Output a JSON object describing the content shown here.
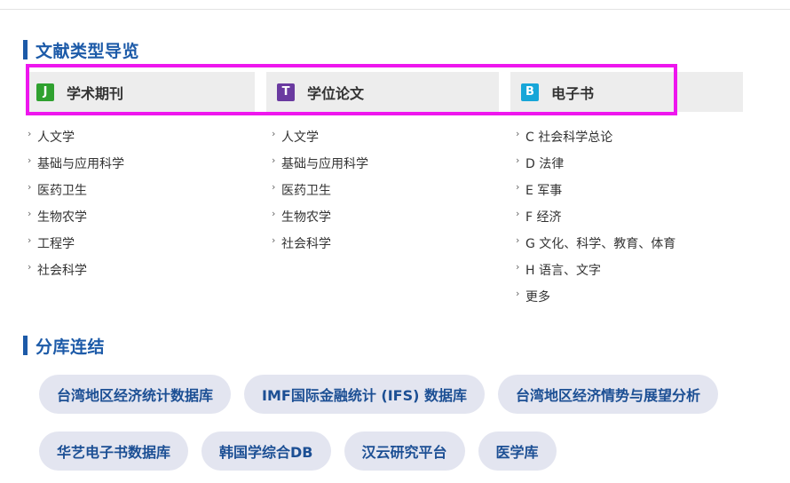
{
  "nav_section": {
    "title": "文献类型导览",
    "categories": [
      {
        "badge": "J",
        "badge_color": "#2fa12f",
        "label": "学术期刊",
        "links": [
          "人文学",
          "基础与应用科学",
          "医药卫生",
          "生物农学",
          "工程学",
          "社会科学"
        ]
      },
      {
        "badge": "T",
        "badge_color": "#6a3aa0",
        "label": "学位论文",
        "links": [
          "人文学",
          "基础与应用科学",
          "医药卫生",
          "生物农学",
          "社会科学"
        ]
      },
      {
        "badge": "B",
        "badge_color": "#17a6d8",
        "label": "电子书",
        "links": [
          "C 社会科学总论",
          "D 法律",
          "E 军事",
          "F 经济",
          "G 文化、科学、教育、体育",
          "H 语言、文字",
          "更多"
        ]
      }
    ]
  },
  "sub_db_section": {
    "title": "分库连结",
    "row1": [
      "台湾地区经济统计数据库",
      "IMF国际金融统计 (IFS) 数据库",
      "台湾地区经济情势与展望分析"
    ],
    "row2": [
      "华艺电子书数据库",
      "韩国学综合DB",
      "汉云研究平台",
      "医学库"
    ]
  },
  "colors": {
    "accent": "#1c5aa8",
    "highlight": "#ee16ee",
    "pill_bg": "#e3e5f0",
    "pill_text": "#1c4f94",
    "header_bg": "#ededed"
  }
}
